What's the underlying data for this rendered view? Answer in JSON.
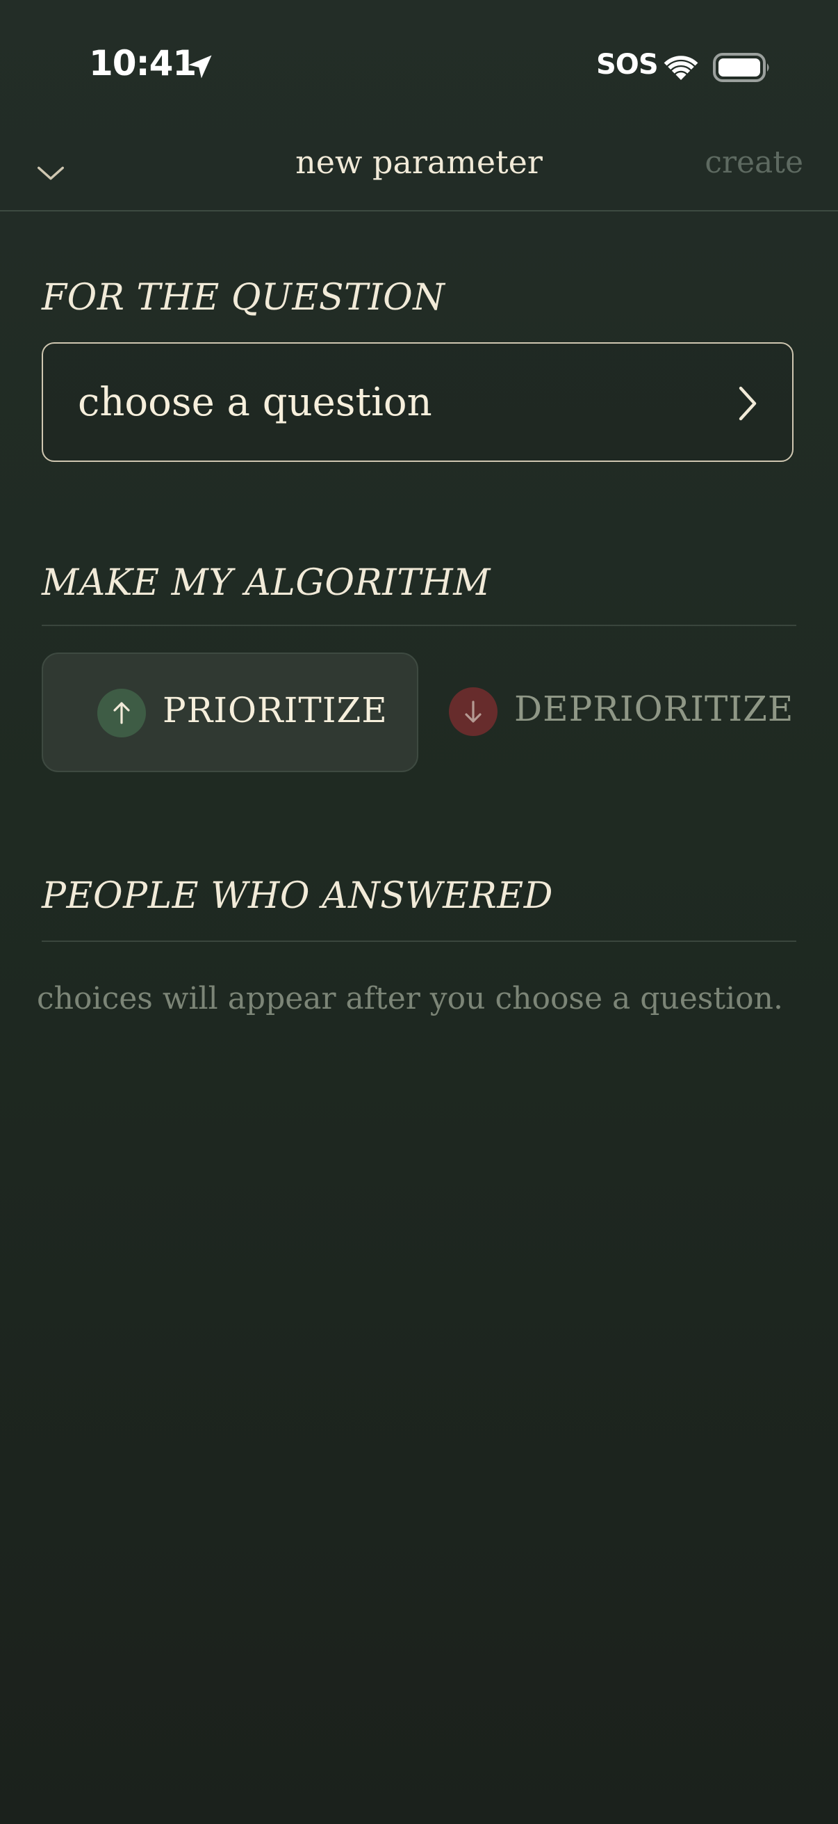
{
  "status_bar": {
    "time": "10:41",
    "sos": "SOS",
    "icons": [
      "location-arrow-icon",
      "wifi-icon",
      "battery-icon"
    ]
  },
  "nav": {
    "title": "new parameter",
    "create_label": "create",
    "dismiss_icon": "chevron-down-icon"
  },
  "question_section": {
    "heading": "FOR THE QUESTION",
    "picker_label": "choose a question",
    "picker_icon": "chevron-right-icon"
  },
  "algorithm_section": {
    "heading": "MAKE MY ALGORITHM",
    "options": [
      {
        "label": "PRIORITIZE",
        "icon": "arrow-up-icon",
        "selected": true,
        "accent": "#3e5c45"
      },
      {
        "label": "DEPRIORITIZE",
        "icon": "arrow-down-icon",
        "selected": false,
        "accent": "#672c2c"
      }
    ]
  },
  "people_section": {
    "heading": "PEOPLE WHO ANSWERED",
    "empty_message": "choices will appear after you choose a question."
  },
  "colors": {
    "background": "#1f2a22",
    "text": "#f1ead8",
    "muted": "#7c8577"
  }
}
